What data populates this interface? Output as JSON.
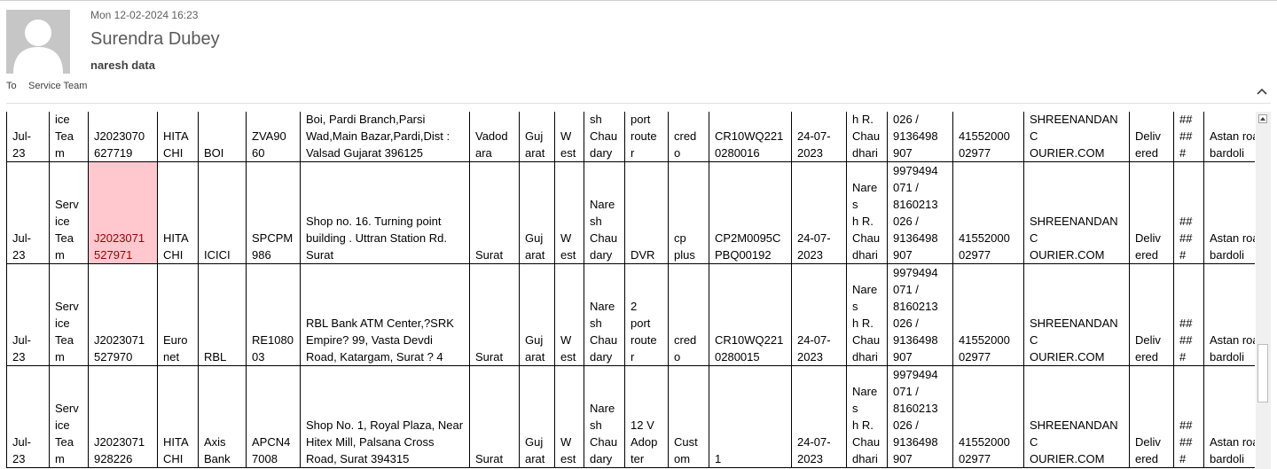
{
  "email": {
    "date": "Mon 12-02-2024 16:23",
    "sender": "Surendra Dubey",
    "subject": "naresh data",
    "to_label": "To",
    "to_value": "Service Team"
  },
  "table": {
    "rows": [
      {
        "cells": [
          "Jul-\n23",
          "ice\nTea\nm",
          "J2023070\n627719",
          "HITA\nCHI",
          "BOI",
          "ZVA90\n60",
          "Boi, Pardi Branch,Parsi Wad,Main Bazar,Pardi,Dist : Valsad Gujarat 396125",
          "Vadod\nara",
          "Guj\narat",
          "W\nest",
          "sh\nChau\ndary",
          "port\nroute\nr",
          "cred\no",
          "CR10WQ221\n0280016",
          "24-07-\n2023",
          "h R.\nChau\ndhari",
          "026 /\n9136498\n907",
          "41552000\n02977",
          "SHREENANDANC\nOURIER.COM",
          "Deliv\nered",
          "##\n##\n#",
          "Astan road,\nbardoli"
        ]
      },
      {
        "cells": [
          "Jul-\n23",
          "Serv\nice\nTea\nm",
          "J2023071\n527971",
          "HITA\nCHI",
          "ICICI",
          "SPCPM\n986",
          "Shop no. 16. Turning point building . Uttran Station Rd. Surat",
          "Surat",
          "Guj\narat",
          "W\nest",
          "Nare\nsh\nChau\ndary",
          "DVR",
          "cp\nplus",
          "CP2M0095C\nPBQ00192",
          "24-07-\n2023",
          "Nares\nh R.\nChau\ndhari",
          "9979494\n071 /\n8160213\n026 /\n9136498\n907",
          "41552000\n02977",
          "SHREENANDANC\nOURIER.COM",
          "Deliv\nered",
          "##\n##\n#",
          "Astan road,\nbardoli"
        ]
      },
      {
        "cells": [
          "Jul-\n23",
          "Serv\nice\nTea\nm",
          "J2023071\n527970",
          "Euro\nnet",
          "RBL",
          "RE1080\n03",
          "RBL Bank ATM Center,?SRK Empire? 99, Vasta Devdi Road, Katargam, Surat ? 4",
          "Surat",
          "Guj\narat",
          "W\nest",
          "Nare\nsh\nChau\ndary",
          "2\nport\nroute\nr",
          "cred\no",
          "CR10WQ221\n0280015",
          "24-07-\n2023",
          "Nares\nh R.\nChau\ndhari",
          "9979494\n071 /\n8160213\n026 /\n9136498\n907",
          "41552000\n02977",
          "SHREENANDANC\nOURIER.COM",
          "Deliv\nered",
          "##\n##\n#",
          "Astan road,\nbardoli"
        ]
      },
      {
        "cells": [
          "Jul-\n23",
          "Serv\nice\nTea\nm",
          "J2023071\n928226",
          "HITA\nCHI",
          "Axis\nBank",
          "APCN4\n7008",
          "Shop No. 1, Royal Plaza, Near Hitex Mill, Palsana Cross Road, Surat 394315",
          "Surat",
          "Guj\narat",
          "W\nest",
          "Nare\nsh\nChau\ndary",
          "12 V\nAdop\nter",
          "Cust\nom",
          "1",
          "24-07-\n2023",
          "Nares\nh R.\nChau\ndhari",
          "9979494\n071 /\n8160213\n026 /\n9136498\n907",
          "41552000\n02977",
          "SHREENANDANC\nOURIER.COM",
          "Deliv\nered",
          "##\n##\n#",
          "Astan road,\nbardoli"
        ]
      }
    ]
  }
}
